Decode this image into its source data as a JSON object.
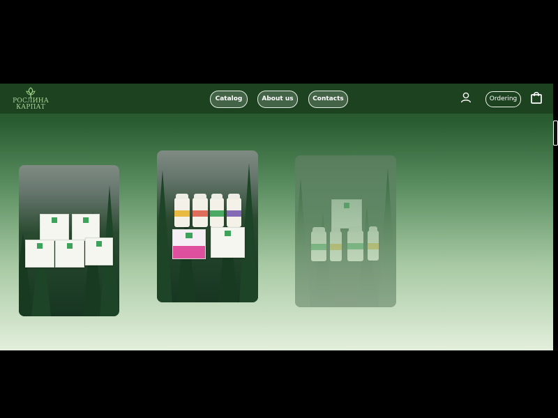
{
  "brand": {
    "line1": "РОСЛИНА",
    "line2": "КАРПАТ"
  },
  "nav": {
    "items": [
      "Catalog",
      "About us",
      "Contacts"
    ]
  },
  "actions": {
    "ordering_label": "Ordering"
  },
  "icons": {
    "logo": "leaf-logo-icon",
    "user": "user-icon",
    "cart": "shopping-bag-icon"
  },
  "products": [
    {
      "name": "herbal-sachet-boxes-card"
    },
    {
      "name": "supplement-jars-card"
    },
    {
      "name": "extract-bottles-card"
    }
  ]
}
